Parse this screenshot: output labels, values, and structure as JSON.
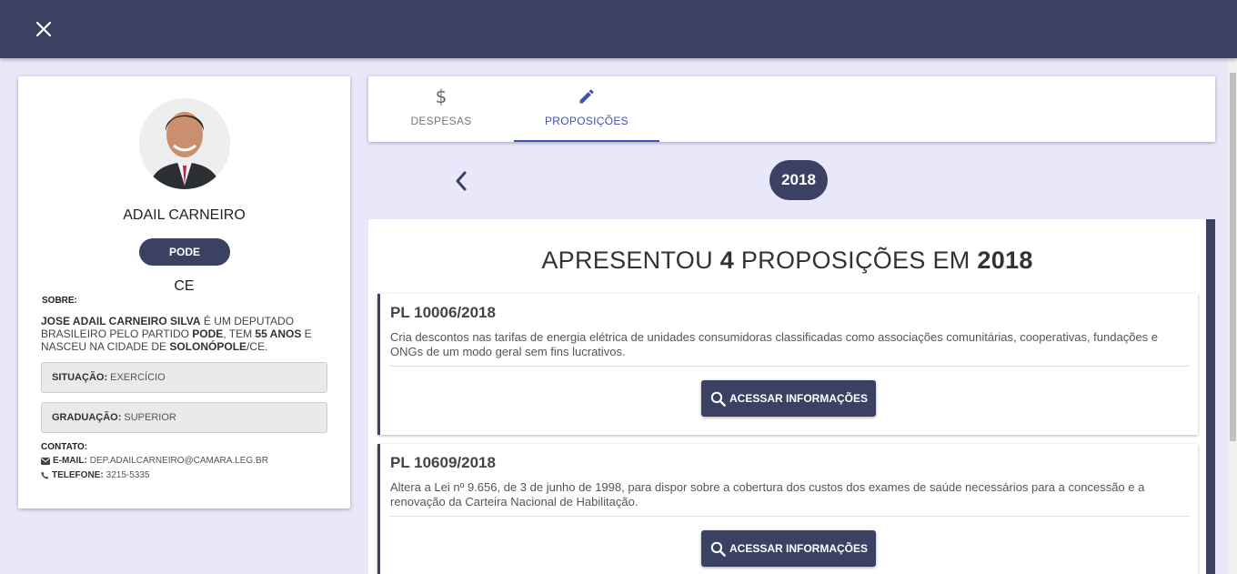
{
  "header": {
    "close_icon": "close-icon"
  },
  "profile": {
    "name": "ADAIL CARNEIRO",
    "party": "PODE",
    "state": "CE",
    "sobre_label": "SOBRE:",
    "bio": {
      "full_name": "JOSE ADAIL CARNEIRO SILVA",
      "text1": " É UM DEPUTADO BRASILEIRO PELO PARTIDO ",
      "party": "PODE",
      "text2": ", TEM ",
      "age": "55 ANOS",
      "text3": " E NASCEU NA CIDADE DE ",
      "city": "SOLONÓPOLE",
      "text4": "/CE."
    },
    "situacao": {
      "label": "SITUAÇÃO:",
      "value": "EXERCÍCIO"
    },
    "graduacao": {
      "label": "GRADUAÇÃO:",
      "value": "SUPERIOR"
    },
    "contato_label": "CONTATO:",
    "email": {
      "label": "E-MAIL:",
      "value": "DEP.ADAILCARNEIRO@CAMARA.LEG.BR",
      "icon": "envelope-icon"
    },
    "telefone": {
      "label": "TELEFONE:",
      "value": "3215-5335",
      "icon": "phone-icon"
    }
  },
  "tabs": [
    {
      "label": "DESPESAS",
      "icon": "dollar-icon",
      "active": false
    },
    {
      "label": "PROPOSIÇÕES",
      "icon": "pencil-icon",
      "active": true
    }
  ],
  "year_nav": {
    "year": "2018",
    "prev_icon": "chevron-left-icon"
  },
  "summary": {
    "prefix": "APRESENTOU ",
    "count": "4",
    "middle": " PROPOSIÇÕES EM ",
    "year": "2018"
  },
  "proposicoes": [
    {
      "title": "PL 10006/2018",
      "description": "Cria descontos nas tarifas de energia elétrica de unidades consumidoras classificadas como associações comunitárias, cooperativas, fundações e ONGs de um modo geral sem fins lucrativos.",
      "button_label": "ACESSAR INFORMAÇÕES"
    },
    {
      "title": "PL 10609/2018",
      "description": "Altera a Lei nº 9.656, de 3 de junho de 1998, para dispor sobre a cobertura dos custos dos exames de saúde necessários para a concessão e a renovação da Carteira Nacional de Habilitação.",
      "button_label": "ACESSAR INFORMAÇÕES"
    }
  ],
  "colors": {
    "primary": "#3a4163",
    "accent": "#3f51b5",
    "background": "#e8e8fa"
  }
}
